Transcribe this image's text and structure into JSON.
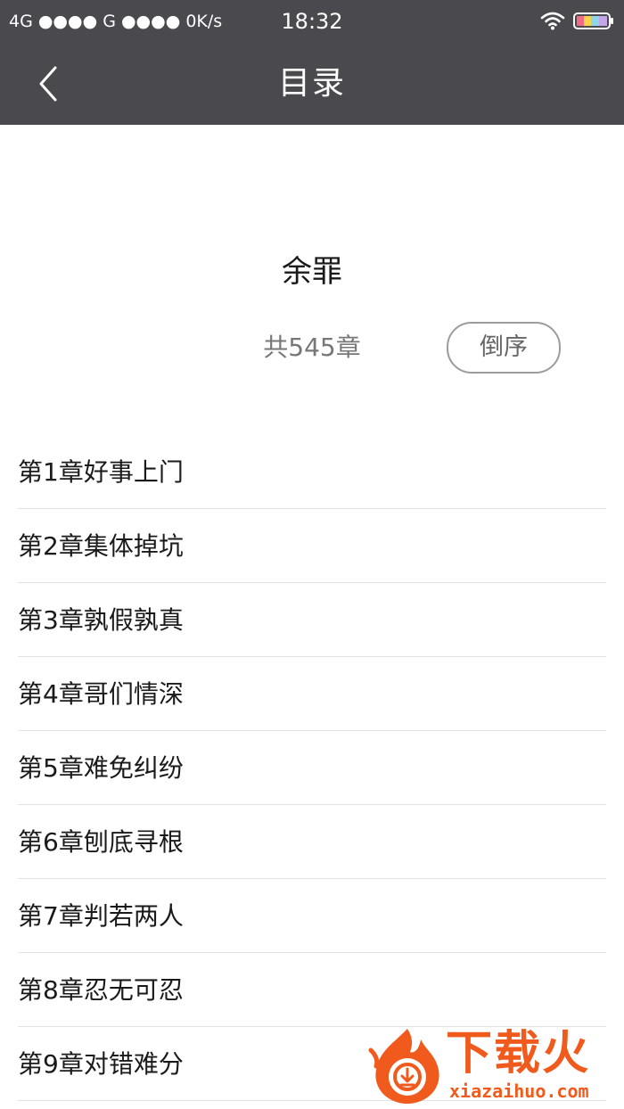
{
  "status_bar": {
    "signal": "4G ●●●● G ●●●● 0K/s",
    "time": "18:32",
    "wifi_icon": "wifi-icon",
    "battery_icon": "battery-icon"
  },
  "nav": {
    "back_icon": "chevron-left-icon",
    "title": "目录"
  },
  "book": {
    "title": "余罪",
    "chapter_count": "共545章",
    "sort_label": "倒序"
  },
  "chapters": [
    "第1章好事上门",
    "第2章集体掉坑",
    "第3章孰假孰真",
    "第4章哥们情深",
    "第5章难免纠纷",
    "第6章刨底寻根",
    "第7章判若两人",
    "第8章忍无可忍",
    "第9章对错难分"
  ],
  "watermark": {
    "brand": "下载火",
    "url": "xiazaihuo.com",
    "color": "#f05a1c"
  },
  "colors": {
    "topbar": "#4a494e",
    "divider": "#e2e2e2"
  }
}
